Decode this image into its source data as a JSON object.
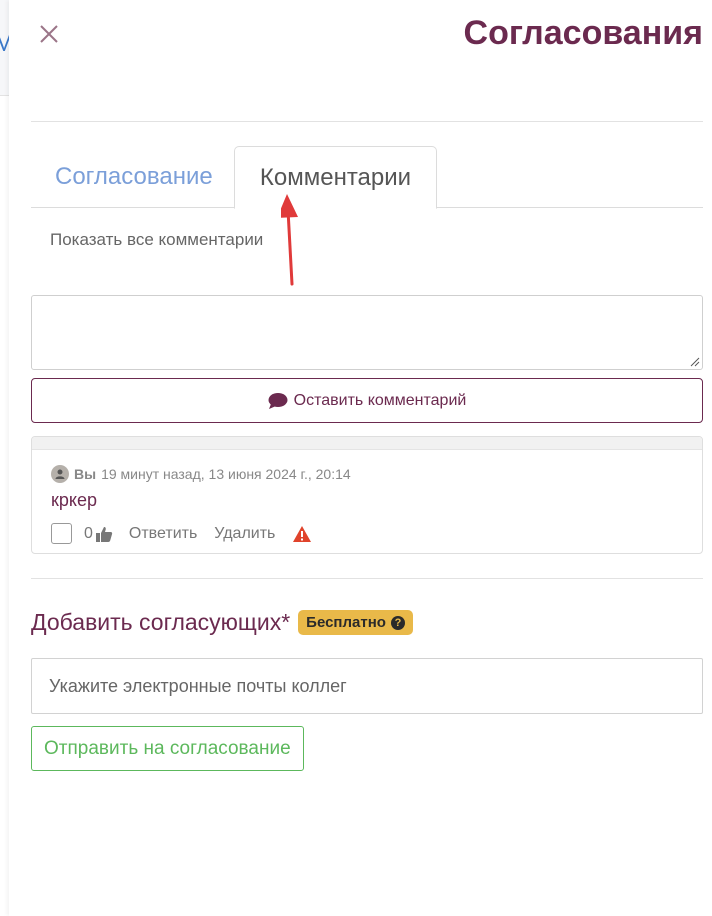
{
  "background": {
    "peek_text": "M"
  },
  "panel": {
    "title": "Согласования",
    "close_icon": "close-icon"
  },
  "tabs": [
    {
      "label": "Согласование",
      "active": false
    },
    {
      "label": "Комментарии",
      "active": true
    }
  ],
  "comments": {
    "show_all": "Показать все комментарии",
    "input_placeholder": "",
    "leave_button": "Оставить комментарий",
    "items": [
      {
        "author": "Вы",
        "time": "19 минут назад, 13 июня 2024 г., 20:14",
        "text": "кркер",
        "likes": "0",
        "reply": "Ответить",
        "delete": "Удалить"
      }
    ]
  },
  "approvers": {
    "title": "Добавить согласующих*",
    "badge": "Бесплатно",
    "badge_help": "?",
    "email_placeholder": "Укажите электронные почты коллег",
    "send_button": "Отправить на согласование"
  },
  "colors": {
    "brand": "#6b2a4f",
    "tab_inactive": "#7b9fd9",
    "success": "#5cb85c",
    "badge": "#e9b949",
    "warning": "#e0432b",
    "annotation_arrow": "#e03a3a"
  }
}
